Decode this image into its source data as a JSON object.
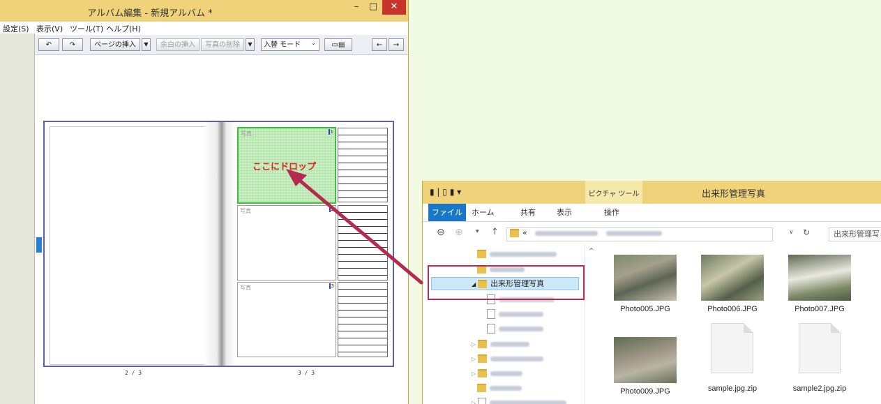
{
  "album": {
    "title": "アルバム編集 - 新規アルバム *",
    "window_controls": {
      "minimize": "–",
      "maximize": "□",
      "close": "✕"
    },
    "menu": [
      {
        "label": "設定(S)"
      },
      {
        "label": "表示(V)"
      },
      {
        "label": "ツール(T)"
      },
      {
        "label": "ヘルプ(H)"
      }
    ],
    "toolbar": {
      "undo_icon": "↶",
      "redo_icon": "↷",
      "insert_page": "ページの挿入",
      "insert_blank": "余白の挿入",
      "delete_photo": "写真の削除",
      "mode": "入替 モード",
      "prev": "←",
      "next": "→"
    },
    "photo_label": "写真",
    "photo_numbers": [
      "1",
      "2",
      "3"
    ],
    "drop_hint": "ここにドロップ",
    "page_numbers": {
      "left": "2 / 3",
      "right": "3 / 3"
    }
  },
  "explorer": {
    "title": "出来形管理写真",
    "picture_tools": "ピクチャ ツール",
    "ribbon_tabs": [
      {
        "label": "ファイル"
      },
      {
        "label": "ホーム"
      },
      {
        "label": "共有"
      },
      {
        "label": "表示"
      },
      {
        "label": "操作"
      }
    ],
    "address_prefix": "«",
    "search_placeholder": "出来形管理写",
    "selected_folder": "出来形管理写真",
    "files": [
      {
        "name": "Photo005.JPG",
        "kind": "photo"
      },
      {
        "name": "Photo006.JPG",
        "kind": "photo"
      },
      {
        "name": "Photo007.JPG",
        "kind": "photo"
      },
      {
        "name": "Photo009.JPG",
        "kind": "photo"
      },
      {
        "name": "sample.jpg.zip",
        "kind": "zip"
      },
      {
        "name": "sample2.jpg.zip",
        "kind": "zip"
      }
    ]
  },
  "colors": {
    "titlebar": "#f0d27a",
    "close_button": "#c7342a",
    "drop_target": "#3fbf3f",
    "drop_text": "#e0231c",
    "arrow": "#b32b4e",
    "ribbon_file": "#1a76c7"
  }
}
